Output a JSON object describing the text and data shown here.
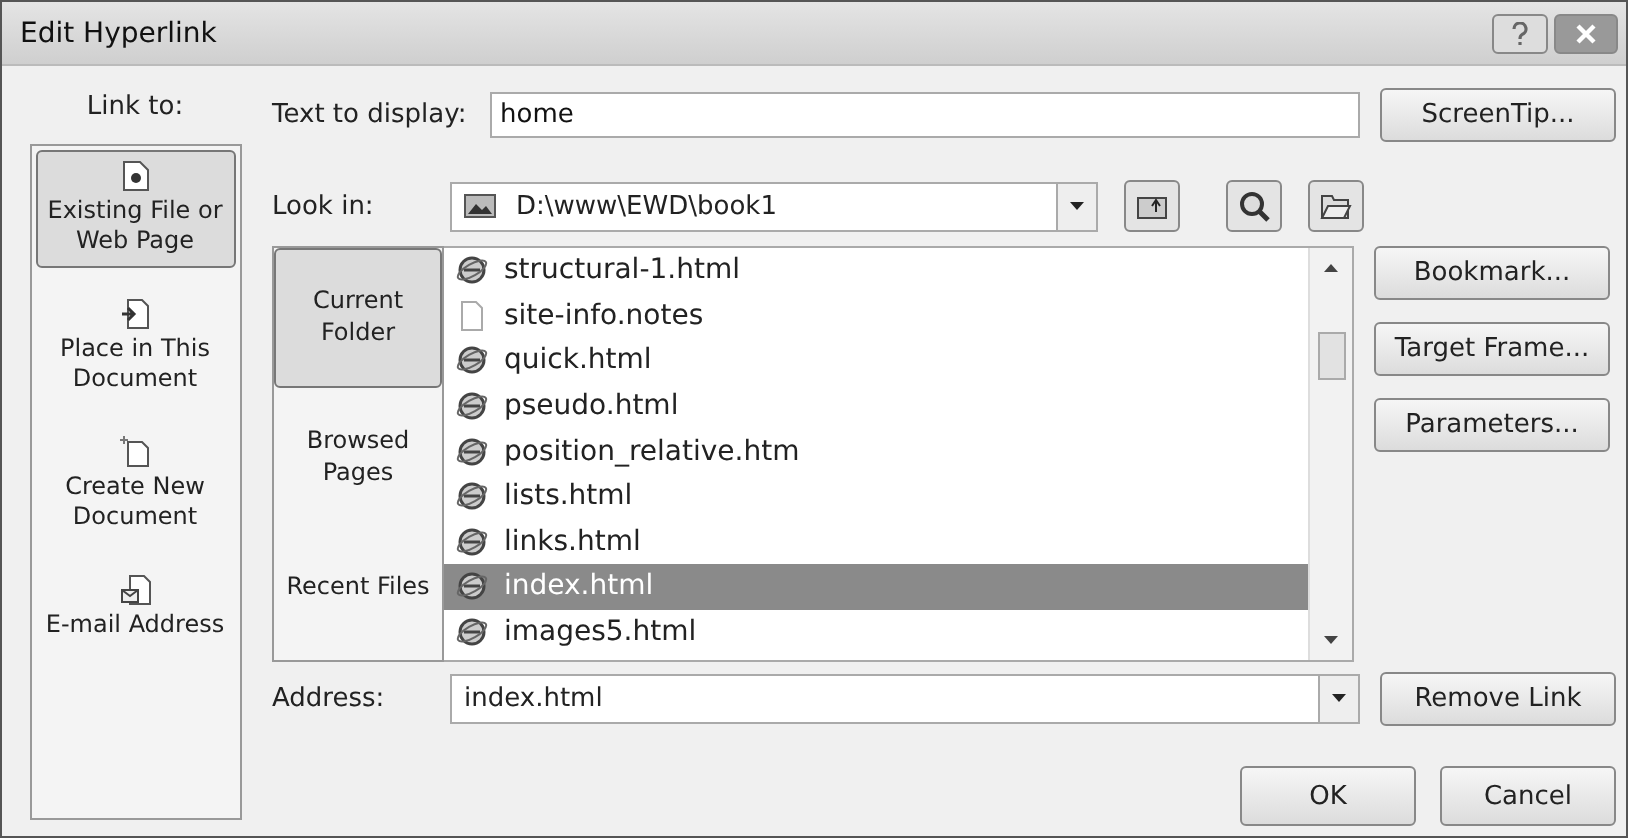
{
  "window": {
    "title": "Edit Hyperlink"
  },
  "link_to": {
    "label": "Link to:",
    "items": [
      {
        "label": "Existing File or Web Page",
        "kind": "file",
        "selected": true
      },
      {
        "label": "Place in This Document",
        "kind": "place",
        "selected": false
      },
      {
        "label": "Create New Document",
        "kind": "new",
        "selected": false
      },
      {
        "label": "E-mail Address",
        "kind": "email",
        "selected": false
      }
    ]
  },
  "text_to_display": {
    "label": "Text to display:",
    "value": "home"
  },
  "look_in": {
    "label": "Look in:",
    "value": "D:\\www\\EWD\\book1"
  },
  "sources": [
    {
      "label": "Current Folder",
      "selected": true
    },
    {
      "label": "Browsed Pages",
      "selected": false
    },
    {
      "label": "Recent Files",
      "selected": false
    }
  ],
  "files": [
    {
      "name": "structural-1.html",
      "kind": "web",
      "selected": false
    },
    {
      "name": "site-info.notes",
      "kind": "blank",
      "selected": false
    },
    {
      "name": "quick.html",
      "kind": "web",
      "selected": false
    },
    {
      "name": "pseudo.html",
      "kind": "web",
      "selected": false
    },
    {
      "name": "position_relative.htm",
      "kind": "web",
      "selected": false
    },
    {
      "name": "lists.html",
      "kind": "web",
      "selected": false
    },
    {
      "name": "links.html",
      "kind": "web",
      "selected": false
    },
    {
      "name": "index.html",
      "kind": "web",
      "selected": true
    },
    {
      "name": "images5.html",
      "kind": "web",
      "selected": false
    }
  ],
  "address": {
    "label": "Address:",
    "value": "index.html"
  },
  "side_buttons": [
    "ScreenTip...",
    "Bookmark...",
    "Target Frame...",
    "Parameters...",
    "Remove Link"
  ],
  "buttons": [
    "OK",
    "Cancel"
  ]
}
